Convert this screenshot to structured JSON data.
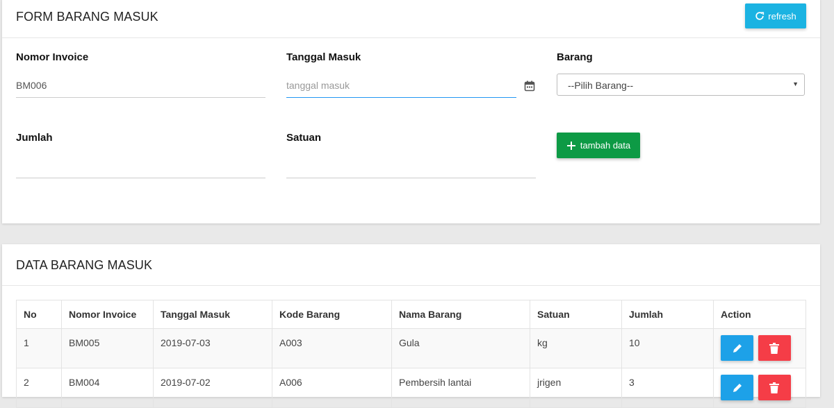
{
  "form": {
    "title": "FORM BARANG MASUK",
    "refresh_label": "refresh",
    "invoice_label": "Nomor Invoice",
    "invoice_value": "BM006",
    "date_label": "Tanggal Masuk",
    "date_placeholder": "tanggal masuk",
    "item_label": "Barang",
    "item_selected": "--Pilih Barang--",
    "qty_label": "Jumlah",
    "unit_label": "Satuan",
    "add_label": "tambah data"
  },
  "data_section": {
    "title": "DATA BARANG MASUK",
    "columns": [
      "No",
      "Nomor Invoice",
      "Tanggal Masuk",
      "Kode Barang",
      "Nama Barang",
      "Satuan",
      "Jumlah",
      "Action"
    ],
    "rows": [
      [
        "1",
        "BM005",
        "2019-07-03",
        "A003",
        "Gula",
        "kg",
        "10"
      ],
      [
        "2",
        "BM004",
        "2019-07-02",
        "A006",
        "Pembersih lantai",
        "jrigen",
        "3"
      ]
    ]
  },
  "colors": {
    "refresh": "#1bb3e2",
    "add": "#0d9a45",
    "edit": "#1da1e8",
    "delete": "#f53d47",
    "focus_underline": "#2196f3"
  },
  "icons": {
    "refresh": "refresh-icon",
    "calendar": "calendar-icon",
    "add": "plus-icon",
    "edit": "pencil-icon",
    "delete": "trash-icon"
  }
}
